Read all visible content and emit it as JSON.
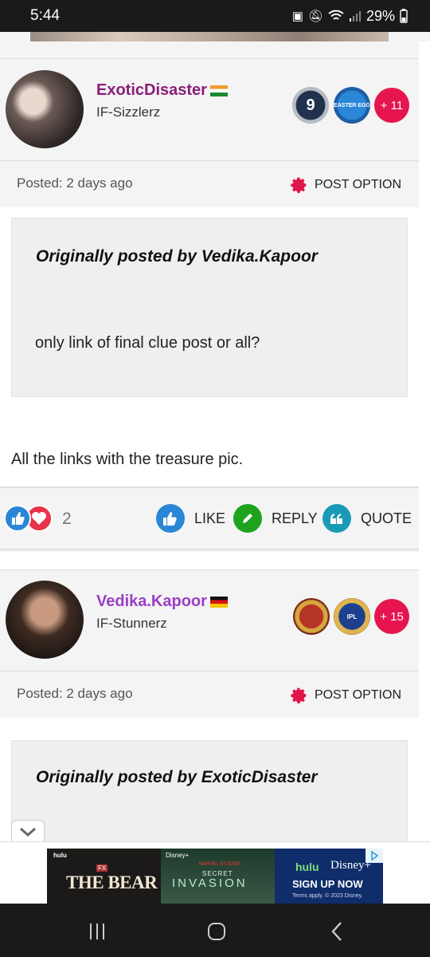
{
  "status_bar": {
    "time": "5:44",
    "battery": "29%"
  },
  "posts": [
    {
      "username": "ExoticDisaster",
      "group": "IF-Sizzlerz",
      "badge_level": "9",
      "badge_event": "EASTER EGG",
      "badge_year": "2023",
      "extra_badges": "+ 11",
      "posted": "Posted: 2 days ago",
      "post_option": "POST OPTION",
      "quote_author": "Originally posted by Vedika.Kapoor",
      "quote_text": "only link of final clue post or all?",
      "reply_text": "All the links with the treasure pic.",
      "reaction_count": "2",
      "like": "LIKE",
      "reply": "REPLY",
      "quote": "QUOTE"
    },
    {
      "username": "Vedika.Kapoor",
      "group": "IF-Stunnerz",
      "badge_event": "IPL",
      "badge_year": "2023",
      "extra_badges": "+ 15",
      "posted": "Posted: 2 days ago",
      "post_option": "POST OPTION",
      "quote_author": "Originally posted by ExoticDisaster"
    }
  ],
  "ad": {
    "hulu": "hulu",
    "fx": "FX",
    "show1": "THE BEAR",
    "disney_small": "Disney+",
    "marvel": "MARVEL STUDIOS",
    "secret": "SECRET",
    "invasion": "INVASION",
    "hulu2": "hulu",
    "disney": "Disney+",
    "cta": "SIGN UP NOW",
    "terms": "Terms apply. © 2023 Disney."
  },
  "icons": {
    "status": [
      "image-icon",
      "mute-icon",
      "wifi-icon",
      "signal-icon",
      "battery-icon"
    ],
    "nav": [
      "recents-icon",
      "home-icon",
      "back-icon"
    ]
  }
}
